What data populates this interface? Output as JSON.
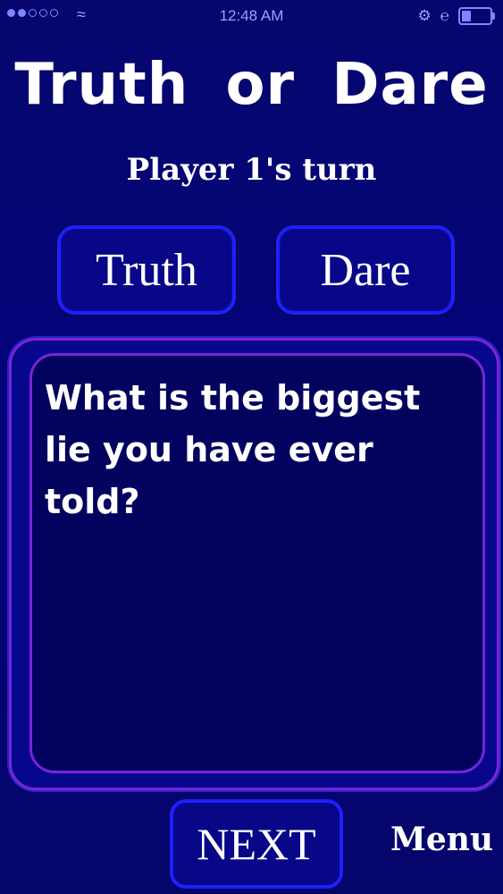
{
  "status_bar": {
    "time": "12:48 AM",
    "signal_icon": "signal-dots-icon",
    "wifi_icon": "wifi-icon",
    "battery_icon": "battery-icon"
  },
  "header": {
    "title": "Truth or Dare",
    "turn": "Player 1's turn"
  },
  "choices": {
    "truth_label": "Truth",
    "dare_label": "Dare"
  },
  "card": {
    "question": "What is the biggest lie you have ever told?"
  },
  "footer": {
    "next_label": "NEXT",
    "menu_label": "Menu"
  },
  "colors": {
    "background": "#04047a",
    "button_border": "#1f1fff",
    "card_border": "#7a24d6",
    "card_fill": "#03035f"
  }
}
